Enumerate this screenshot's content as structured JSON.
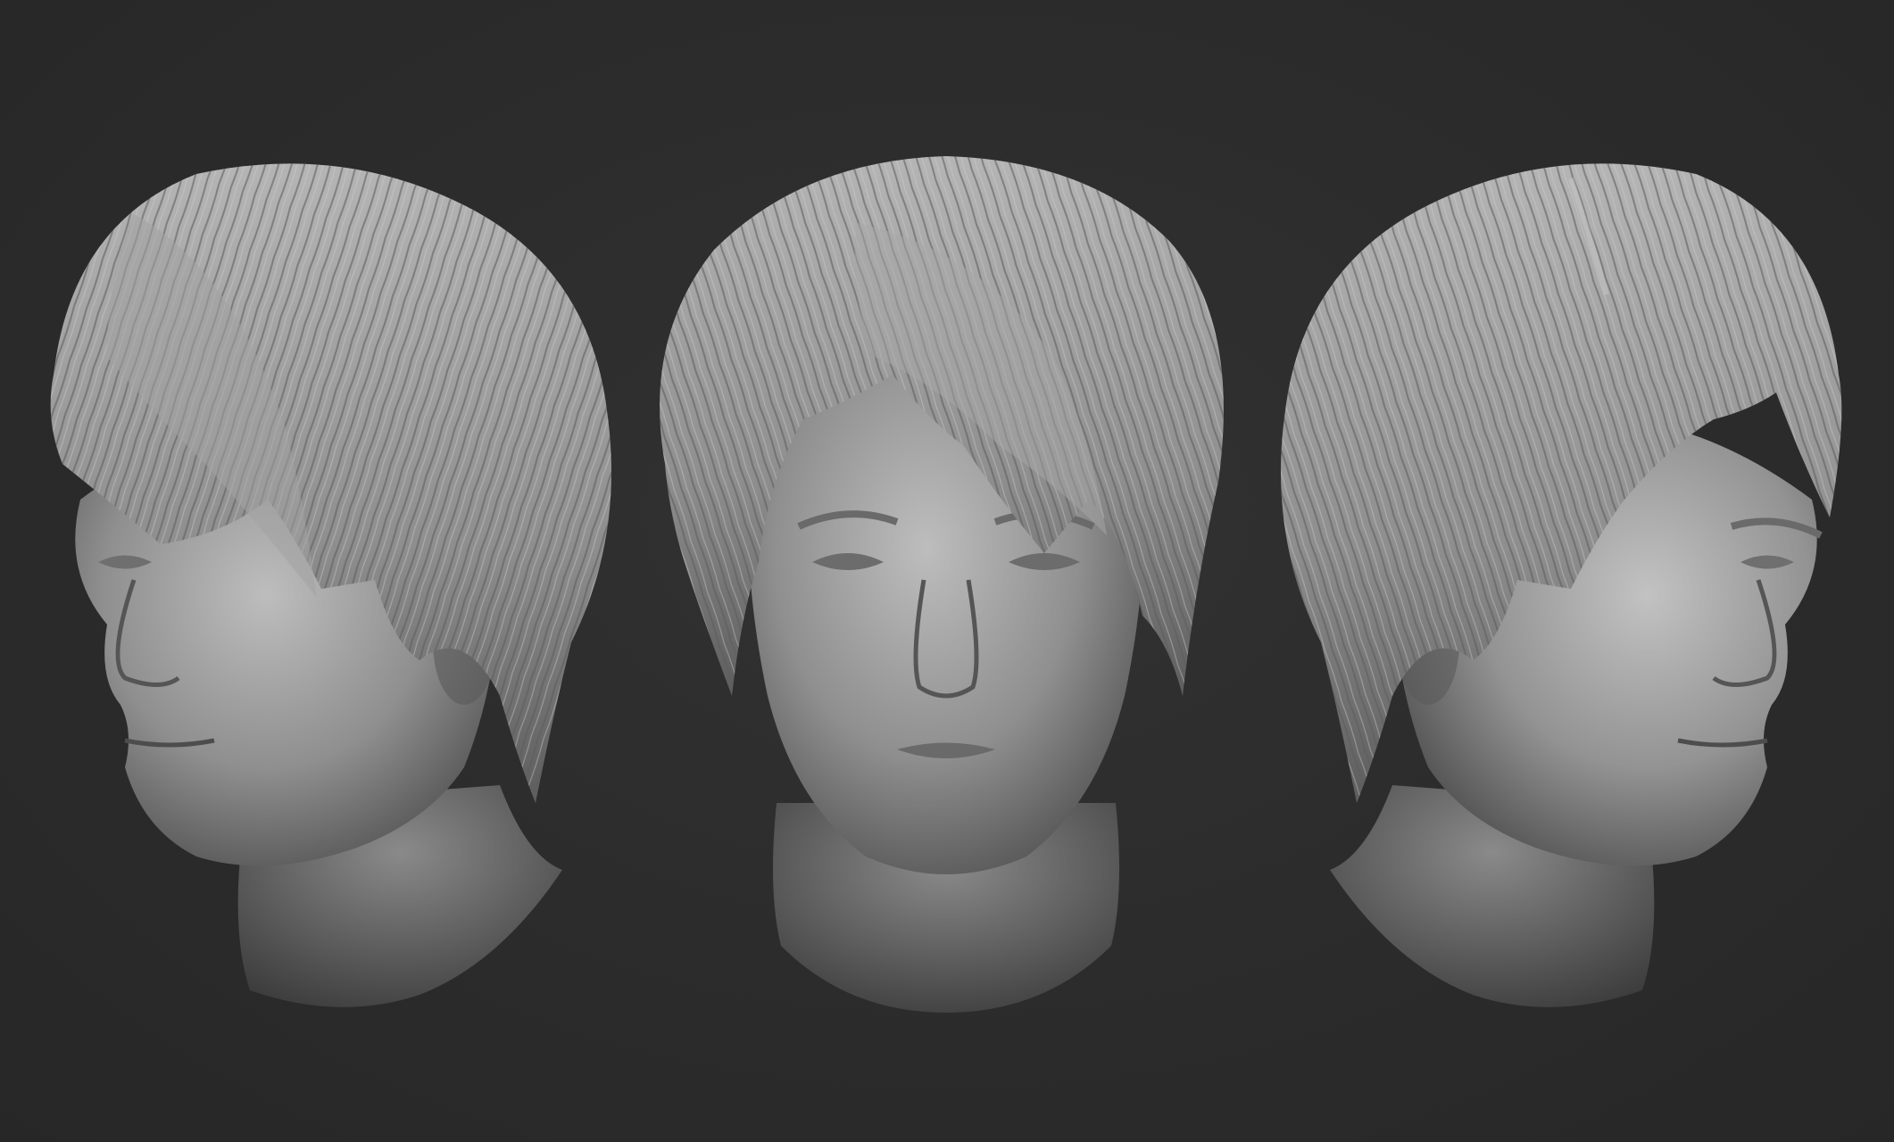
{
  "scene": {
    "background_color": "#2c2c2c",
    "material_color": "#8c8c8c",
    "views": [
      {
        "id": "left",
        "angle": "three-quarter-left"
      },
      {
        "id": "front",
        "angle": "front"
      },
      {
        "id": "right",
        "angle": "three-quarter-right"
      }
    ]
  }
}
